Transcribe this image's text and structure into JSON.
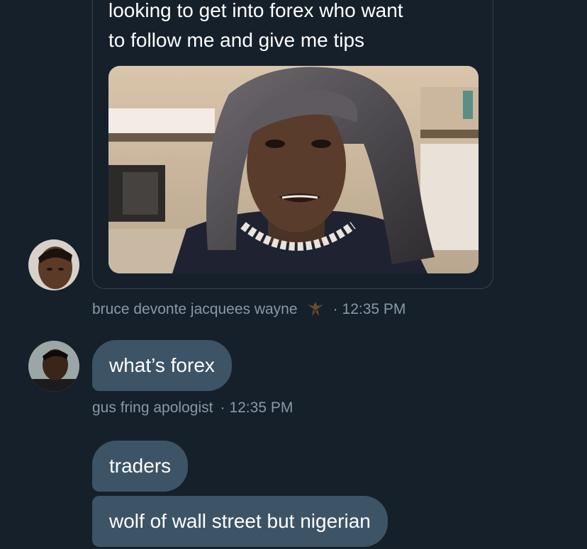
{
  "quoted_message": {
    "text_lines": [
      "looking to get into forex who want",
      "to follow me and give me tips"
    ]
  },
  "messages": [
    {
      "sender": "bruce devonte jacquees wayne",
      "badge_icon": "bat-emoji-icon",
      "separator": "·",
      "time": "12:35 PM"
    },
    {
      "text": "what’s forex",
      "sender": "gus fring apologist",
      "separator": "·",
      "time": "12:35 PM"
    },
    {
      "text": "traders"
    },
    {
      "text": "wolf of wall street but nigerian"
    }
  ],
  "colors": {
    "background": "#15202b",
    "bubble": "#3d5466",
    "meta_text": "#8899a6",
    "card_border": "#38444d"
  }
}
